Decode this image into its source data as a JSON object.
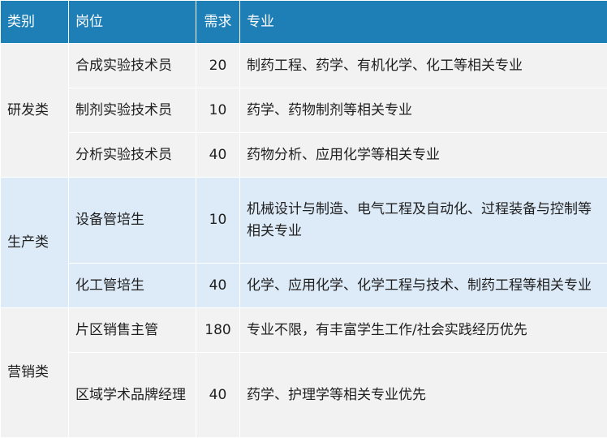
{
  "header": {
    "category": "类别",
    "position": "岗位",
    "demand": "需求",
    "major": "专业"
  },
  "groups": [
    {
      "category": "研发类",
      "rows": [
        {
          "position": "合成实验技术员",
          "demand": "20",
          "major": "制药工程、药学、有机化学、化工等相关专业"
        },
        {
          "position": "制剂实验技术员",
          "demand": "10",
          "major": "药学、药物制剂等相关专业"
        },
        {
          "position": "分析实验技术员",
          "demand": "40",
          "major": "药物分析、应用化学等相关专业"
        }
      ]
    },
    {
      "category": "生产类",
      "rows": [
        {
          "position": "设备管培生",
          "demand": "10",
          "major": "机械设计与制造、电气工程及自动化、过程装备与控制等相关专业"
        },
        {
          "position": "化工管培生",
          "demand": "40",
          "major": "化学、应用化学、化学工程与技术、制药工程等相关专业"
        }
      ]
    },
    {
      "category": "营销类",
      "rows": [
        {
          "position": "片区销售主管",
          "demand": "180",
          "major": "专业不限，有丰富学生工作/社会实践经历优先"
        },
        {
          "position": "区域学术品牌经理",
          "demand": "40",
          "major": "药学、护理学等相关专业优先"
        }
      ]
    }
  ],
  "colors": {
    "header_bg": "#1e7fb6",
    "header_text": "#ffffff",
    "band_gray": "#f2f2f2",
    "band_blue": "#ddeaf7"
  }
}
